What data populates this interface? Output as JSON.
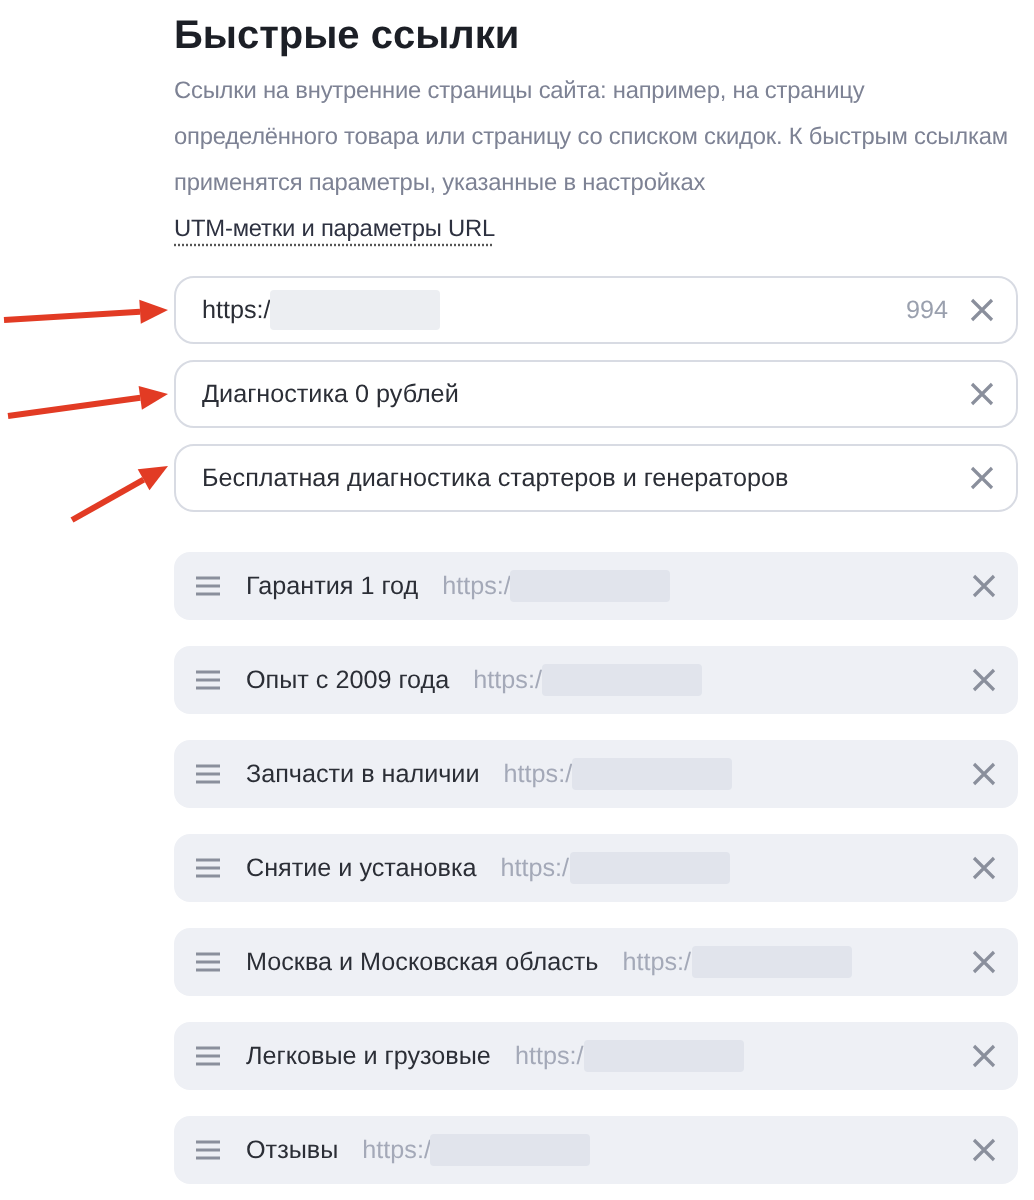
{
  "title": "Быстрые ссылки",
  "description": "Ссылки на внутренние страницы сайта: например, на страницу определённого товара или страницу со списком скидок. К быстрым ссылкам применятся параметры, указанные в настройках ",
  "description_link": "UTM-метки и параметры URL",
  "fields": [
    {
      "value": "https:/",
      "redacted": true,
      "counter": "994",
      "marked": true
    },
    {
      "value": "Диагностика 0 рублей",
      "redacted": false,
      "marked": true
    },
    {
      "value": "Бесплатная диагностика стартеров и генераторов",
      "redacted": false,
      "marked": true
    }
  ],
  "links": [
    {
      "title": "Гарантия 1 год",
      "url": "https:/"
    },
    {
      "title": "Опыт с 2009 года",
      "url": "https:/"
    },
    {
      "title": "Запчасти в наличии",
      "url": "https:/"
    },
    {
      "title": "Снятие и установка",
      "url": "https:/"
    },
    {
      "title": "Москва и Московская область",
      "url": "https:/"
    },
    {
      "title": "Легковые и грузовые",
      "url": "https:/"
    },
    {
      "title": "Отзывы",
      "url": "https:/"
    }
  ]
}
